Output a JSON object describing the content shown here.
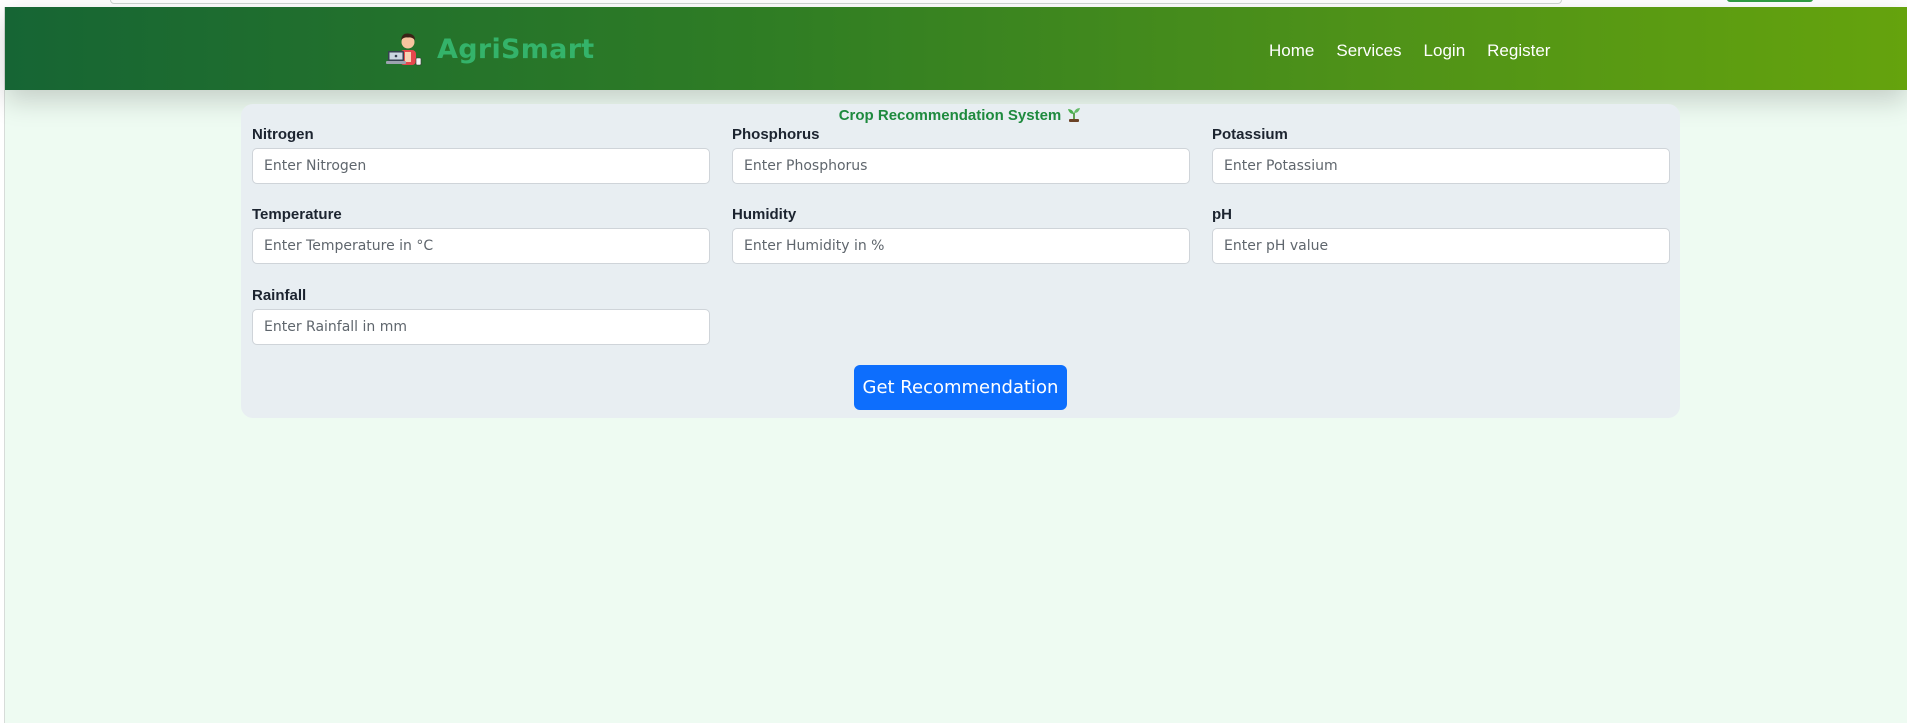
{
  "brand": {
    "name": "AgriSmart",
    "logo_icon": "farmer-with-laptop-icon"
  },
  "nav": {
    "items": [
      {
        "label": "Home"
      },
      {
        "label": "Services"
      },
      {
        "label": "Login"
      },
      {
        "label": "Register"
      }
    ]
  },
  "form": {
    "title": "Crop Recommendation System",
    "title_icon": "sprout-icon",
    "fields": [
      {
        "label": "Nitrogen",
        "placeholder": "Enter Nitrogen",
        "value": ""
      },
      {
        "label": "Phosphorus",
        "placeholder": "Enter Phosphorus",
        "value": ""
      },
      {
        "label": "Potassium",
        "placeholder": "Enter Potassium",
        "value": ""
      },
      {
        "label": "Temperature",
        "placeholder": "Enter Temperature in °C",
        "value": ""
      },
      {
        "label": "Humidity",
        "placeholder": "Enter Humidity in %",
        "value": ""
      },
      {
        "label": "pH",
        "placeholder": "Enter pH value",
        "value": ""
      },
      {
        "label": "Rainfall",
        "placeholder": "Enter Rainfall in mm",
        "value": ""
      }
    ],
    "submit_label": "Get Recommendation"
  },
  "colors": {
    "navbar_start": "#166534",
    "navbar_end": "#65a30d",
    "brand_text": "#34b36a",
    "title_text": "#1e8a3e",
    "button": "#0d6efd",
    "page_background": "#eefbf2",
    "card_background": "#e8eef2"
  }
}
